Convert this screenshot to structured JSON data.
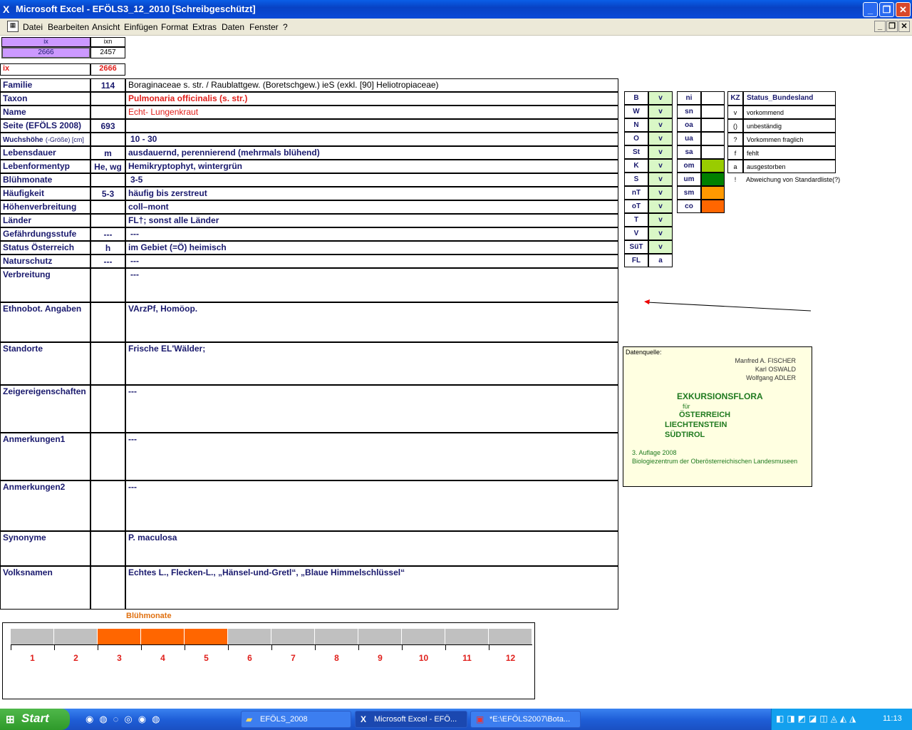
{
  "window": {
    "title": "Microsoft Excel - EFÖLS3_12_2010  [Schreibgeschützt]",
    "min": "_",
    "max": "❐",
    "close": "✕"
  },
  "menu": [
    "Datei",
    "Bearbeiten",
    "Ansicht",
    "Einfügen",
    "Format",
    "Extras",
    "Daten",
    "Fenster",
    "?"
  ],
  "top": {
    "ix_hdr": "ix",
    "ixn_hdr": "ixn",
    "ix_val": "2666",
    "ixn_val": "2457",
    "ix_label": "ix",
    "ix_red": "2666"
  },
  "rows": [
    {
      "label": "Familie",
      "mid": "114",
      "val": "Boraginaceae s. str.  /  Raublattgew. (Boretschgew.) ieS (exkl. [90] Heliotropiaceae)"
    },
    {
      "label": "Taxon",
      "mid": "",
      "val": "Pulmonaria officinalis (s. str.)"
    },
    {
      "label": "Name",
      "mid": "",
      "val": "Echt- Lungenkraut"
    },
    {
      "label": "Seite (EFÖLS 2008)",
      "mid": "693",
      "val": ""
    },
    {
      "label": "Wuchshöhe",
      "label_small": "(-Größe) [cm]",
      "mid": "",
      "val": "10 - 30"
    },
    {
      "label": "Lebensdauer",
      "mid": "m",
      "val": "ausdauernd, perennierend (mehrmals blühend)"
    },
    {
      "label": "Lebenformentyp",
      "mid": "He, wg",
      "val": "Hemikryptophyt, wintergrün"
    },
    {
      "label": "Blühmonate",
      "mid": "",
      "val": "3-5"
    },
    {
      "label": "Häufigkeit",
      "mid": "5-3",
      "val": "häufig bis zerstreut"
    },
    {
      "label": "Höhenverbreitung",
      "mid": "",
      "val": "coll–mont"
    },
    {
      "label": "Länder",
      "mid": "",
      "val": "FL†; sonst alle Länder"
    },
    {
      "label": "Gefährdungsstufe",
      "mid": "---",
      "val": "---"
    },
    {
      "label": "Status Österreich",
      "mid": "h",
      "val": "im Gebiet (=Ö) heimisch"
    },
    {
      "label": "Naturschutz",
      "mid": "---",
      "val": "---"
    },
    {
      "label": "Verbreitung",
      "mid": "",
      "val": "---"
    },
    {
      "label": "Ethnobot. Angaben",
      "mid": "",
      "val": "VArzPf, Homöop."
    },
    {
      "label": "Standorte",
      "mid": "",
      "val": "Frische EL'Wälder;"
    },
    {
      "label": "Zeigereigenschaften",
      "mid": "",
      "val": "---"
    },
    {
      "label": "Anmerkungen1",
      "mid": "",
      "val": "---"
    },
    {
      "label": "Anmerkungen2",
      "mid": "",
      "val": "---"
    },
    {
      "label": "Synonyme",
      "mid": "",
      "val": "P. maculosa"
    },
    {
      "label": "Volksnamen",
      "mid": "",
      "val": "Echtes L., Flecken-L., „Hänsel-und-Gretl“,   „Blaue Himmelschlüssel“"
    }
  ],
  "states": [
    {
      "code": "B",
      "val": "v"
    },
    {
      "code": "W",
      "val": "v"
    },
    {
      "code": "N",
      "val": "v"
    },
    {
      "code": "O",
      "val": "v"
    },
    {
      "code": "St",
      "val": "v"
    },
    {
      "code": "K",
      "val": "v"
    },
    {
      "code": "S",
      "val": "v"
    },
    {
      "code": "nT",
      "val": "v"
    },
    {
      "code": "oT",
      "val": "v"
    },
    {
      "code": "T",
      "val": "v"
    },
    {
      "code": "V",
      "val": "v"
    },
    {
      "code": "SüT",
      "val": "v"
    },
    {
      "code": "FL",
      "val": "a"
    }
  ],
  "altitude": [
    {
      "code": "ni",
      "color": ""
    },
    {
      "code": "sn",
      "color": ""
    },
    {
      "code": "oa",
      "color": ""
    },
    {
      "code": "ua",
      "color": ""
    },
    {
      "code": "sa",
      "color": ""
    },
    {
      "code": "om",
      "color": "#99cc00"
    },
    {
      "code": "um",
      "color": "#008000"
    },
    {
      "code": "sm",
      "color": "#ff9900"
    },
    {
      "code": "co",
      "color": "#ff6600"
    }
  ],
  "legend": {
    "hdr_kz": "KZ",
    "hdr_status": "Status_Bundesland",
    "items": [
      {
        "kz": "v",
        "text": "vorkommend"
      },
      {
        "kz": "()",
        "text": "unbeständig"
      },
      {
        "kz": "?",
        "text": "Vorkommen fraglich"
      },
      {
        "kz": "f",
        "text": "fehlt"
      },
      {
        "kz": "a",
        "text": "ausgestorben"
      },
      {
        "kz": "!",
        "text": "Abweichung von Standardliste(?)"
      }
    ]
  },
  "note": {
    "label": "Datenquelle:",
    "authors": [
      "Manfred A. FISCHER",
      "Karl OSWALD",
      "Wolfgang ADLER"
    ],
    "book": "EXKURSIONSFLORA",
    "fuer": "für",
    "countries": [
      "ÖSTERREICH",
      "LIECHTENSTEIN",
      "SÜDTIROL"
    ],
    "edition": "3. Auflage 2008",
    "publisher": "Biologiezentrum der Oberösterreichischen Landesmuseen"
  },
  "bloom": {
    "title": "Blühmonate",
    "months": [
      "1",
      "2",
      "3",
      "4",
      "5",
      "6",
      "7",
      "8",
      "9",
      "10",
      "11",
      "12"
    ],
    "active": [
      3,
      4,
      5
    ],
    "on_color": "#ff6600",
    "off_color": "#c0c0c0"
  },
  "taskbar": {
    "start": "Start",
    "items": [
      "EFÖLS_2008",
      "Microsoft Excel - EFÖ...",
      "*E:\\EFÖLS2007\\Bota..."
    ],
    "clock": "11:13"
  }
}
